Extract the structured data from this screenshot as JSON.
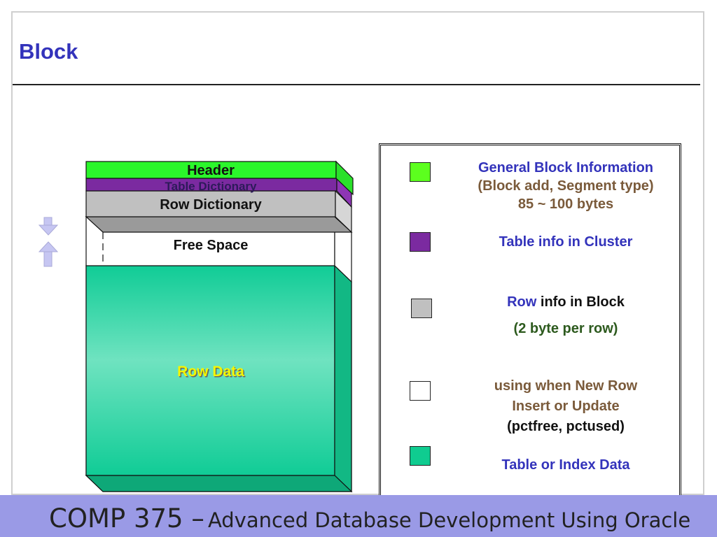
{
  "title": "Block",
  "diagram": {
    "header_label": "Header",
    "table_dictionary_label": "Table Dictionary",
    "row_dictionary_label": "Row Dictionary",
    "free_space_label": "Free Space",
    "row_data_label": "Row Data"
  },
  "legend": {
    "items": [
      {
        "color": "#5cff1e",
        "lines": [
          "General Block Information",
          "(Block add, Segment type)",
          "85 ~ 100 bytes"
        ]
      },
      {
        "color": "#7b2aa0",
        "lines": [
          "Table info in Cluster"
        ]
      },
      {
        "color": "#c0c0c0",
        "lines": [
          "Row",
          "info in Block",
          "(2 byte per row)"
        ]
      },
      {
        "color": "#ffffff",
        "lines": [
          "using when New Row",
          "Insert or  Update",
          "(pctfree, pctused)"
        ]
      },
      {
        "color": "#0fcc90",
        "lines": [
          "Table or Index Data"
        ]
      }
    ]
  },
  "footer": {
    "course_code": "COMP 375 –",
    "course_title": "Advanced Database Development Using Oracle"
  }
}
